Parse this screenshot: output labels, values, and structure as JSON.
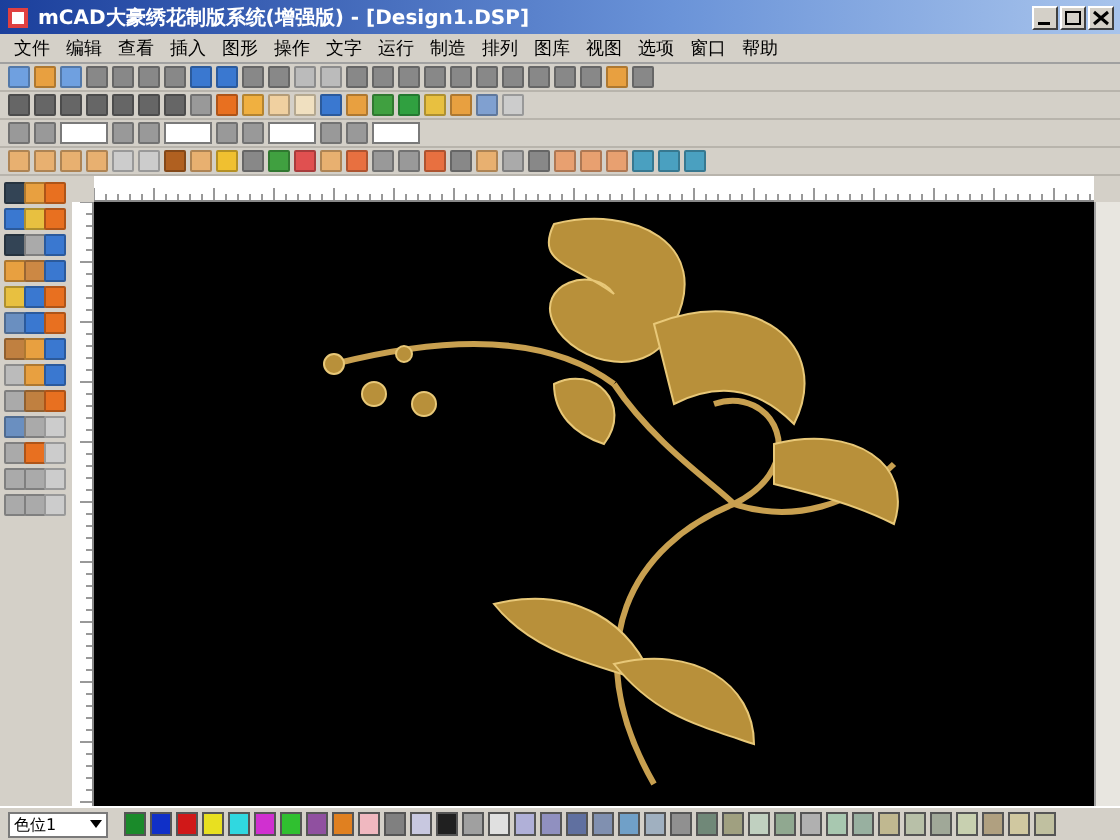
{
  "window": {
    "title": "mCAD大豪绣花制版系统(增强版) - [Design1.DSP]"
  },
  "menu": [
    "文件",
    "编辑",
    "查看",
    "插入",
    "图形",
    "操作",
    "文字",
    "运行",
    "制造",
    "排列",
    "图库",
    "视图",
    "选项",
    "窗口",
    "帮助"
  ],
  "color_select": {
    "value": "色位1"
  },
  "palette": [
    {
      "color": "#1a8a2a"
    },
    {
      "color": "#1030c8"
    },
    {
      "color": "#d01818"
    },
    {
      "color": "#e8e020"
    },
    {
      "color": "#30d8e0"
    },
    {
      "color": "#d030d0"
    },
    {
      "color": "#30c030"
    },
    {
      "color": "#9050a0"
    },
    {
      "color": "#e08020"
    },
    {
      "color": "#f0b8c0"
    },
    {
      "color": "#808080"
    },
    {
      "color": "#c8c8e0"
    },
    {
      "color": "#202020"
    },
    {
      "color": "#a0a0a0"
    },
    {
      "color": "#e0e0e0"
    },
    {
      "color": "#b0b0d8"
    },
    {
      "color": "#9090c0"
    },
    {
      "color": "#6070a0"
    },
    {
      "color": "#8090b0"
    },
    {
      "color": "#70a0c8"
    },
    {
      "color": "#a0b0c0"
    },
    {
      "color": "#909090"
    },
    {
      "color": "#708878"
    },
    {
      "color": "#a0a080"
    },
    {
      "color": "#c0d0c0"
    },
    {
      "color": "#90a890"
    },
    {
      "color": "#b0b0b0"
    },
    {
      "color": "#a8c8b0"
    },
    {
      "color": "#98b0a0"
    },
    {
      "color": "#c0b890"
    },
    {
      "color": "#b8c0a8"
    },
    {
      "color": "#a0a898"
    },
    {
      "color": "#c8d0b0"
    },
    {
      "color": "#b0a080"
    },
    {
      "color": "#d0c8a0"
    },
    {
      "color": "#c0c0a0"
    }
  ]
}
